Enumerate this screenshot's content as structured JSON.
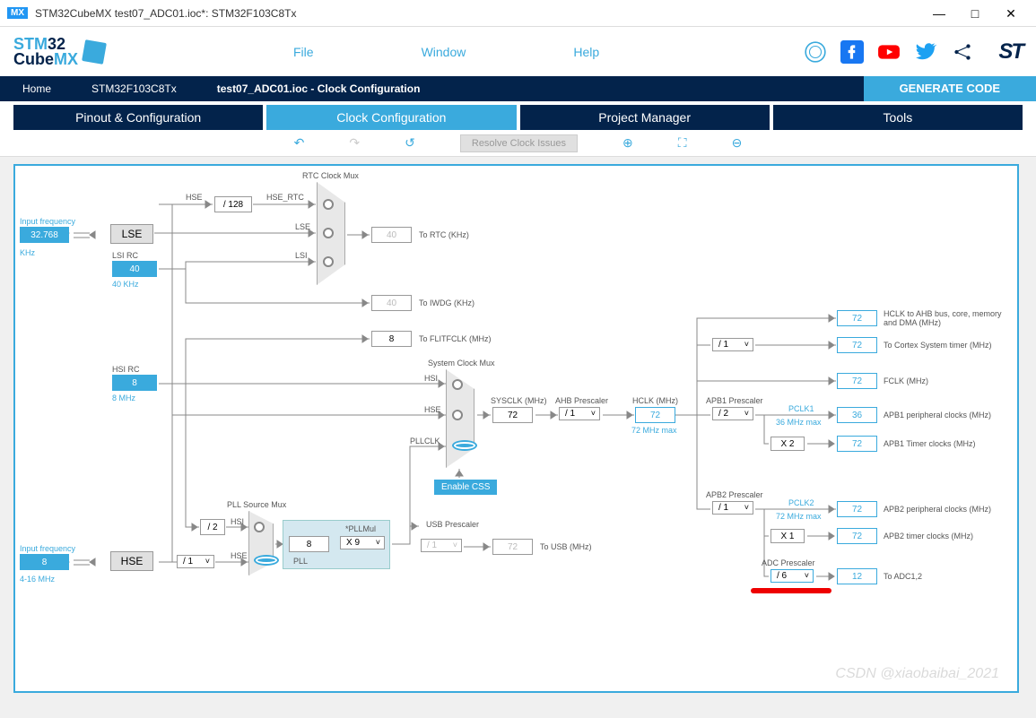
{
  "title": "STM32CubeMX test07_ADC01.ioc*: STM32F103C8Tx",
  "logo": "STM32\nCubeMX",
  "menu": {
    "file": "File",
    "window": "Window",
    "help": "Help"
  },
  "breadcrumb": {
    "home": "Home",
    "chip": "STM32F103C8Tx",
    "file": "test07_ADC01.ioc - Clock Configuration",
    "gen": "GENERATE CODE"
  },
  "tabs": {
    "pinout": "Pinout & Configuration",
    "clock": "Clock Configuration",
    "project": "Project Manager",
    "tools": "Tools"
  },
  "toolbar": {
    "resolve": "Resolve Clock Issues"
  },
  "inputs": {
    "lse_freq": "32.768",
    "lse_unit": "KHz",
    "lse_lbl": "Input frequency",
    "hse_freq": "8",
    "hse_range": "4-16 MHz",
    "hse_lbl": "Input frequency",
    "lse": "LSE",
    "hse": "HSE",
    "lsi_rc": "LSI RC",
    "lsi_val": "40",
    "lsi_unit": "40 KHz",
    "hsi_rc": "HSI RC",
    "hsi_val": "8",
    "hsi_unit": "8 MHz"
  },
  "rtc": {
    "title": "RTC Clock Mux",
    "hse_div": "/ 128",
    "hse_rtc_lbl": "HSE_RTC",
    "hse_lbl": "HSE",
    "lse_lbl": "LSE",
    "lsi_lbl": "LSI",
    "out_val": "40",
    "out_lbl": "To RTC (KHz)",
    "iwdg_val": "40",
    "iwdg_lbl": "To IWDG (KHz)"
  },
  "flit": {
    "val": "8",
    "lbl": "To FLITFCLK (MHz)"
  },
  "sys": {
    "title": "System Clock Mux",
    "hsi": "HSI",
    "hse": "HSE",
    "pllclk": "PLLCLK",
    "sysclk": "72",
    "sysclk_lbl": "SYSCLK (MHz)",
    "css": "Enable CSS"
  },
  "pll": {
    "title": "PLL Source Mux",
    "div2": "/ 2",
    "hsi": "HSI",
    "hse": "HSE",
    "presc_lbl": "*PLLMul",
    "presc": "X 9",
    "input": "8",
    "input_div": "/ 1",
    "out_lbl": "PLL"
  },
  "usb": {
    "title": "USB Prescaler",
    "div": "/ 1",
    "val": "72",
    "lbl": "To USB (MHz)"
  },
  "ahb": {
    "lbl": "AHB Prescaler",
    "div": "/ 1",
    "hclk": "72",
    "hclk_lbl": "HCLK (MHz)",
    "max": "72 MHz max"
  },
  "sys_timer": {
    "div": "/ 1"
  },
  "out": {
    "hclk_ahb": {
      "val": "72",
      "lbl": "HCLK to AHB bus, core, memory and DMA (MHz)"
    },
    "cortex": {
      "val": "72",
      "lbl": "To Cortex System timer (MHz)"
    },
    "fclk": {
      "val": "72",
      "lbl": "FCLK (MHz)"
    },
    "apb1_presc": {
      "lbl": "APB1 Prescaler",
      "div": "/ 2",
      "pclk": "PCLK1",
      "max": "36 MHz max"
    },
    "apb1_periph": {
      "val": "36",
      "lbl": "APB1 peripheral clocks (MHz)"
    },
    "apb1_timer": {
      "mul": "X 2",
      "val": "72",
      "lbl": "APB1 Timer clocks (MHz)"
    },
    "apb2_presc": {
      "lbl": "APB2 Prescaler",
      "div": "/ 1",
      "pclk": "PCLK2",
      "max": "72 MHz max"
    },
    "apb2_periph": {
      "val": "72",
      "lbl": "APB2 peripheral clocks (MHz)"
    },
    "apb2_timer": {
      "mul": "X 1",
      "val": "72",
      "lbl": "APB2 timer clocks (MHz)"
    },
    "adc": {
      "lbl": "ADC Prescaler",
      "div": "/ 6",
      "val": "12",
      "out_lbl": "To ADC1,2"
    }
  },
  "watermark": "CSDN @xiaobaibai_2021"
}
